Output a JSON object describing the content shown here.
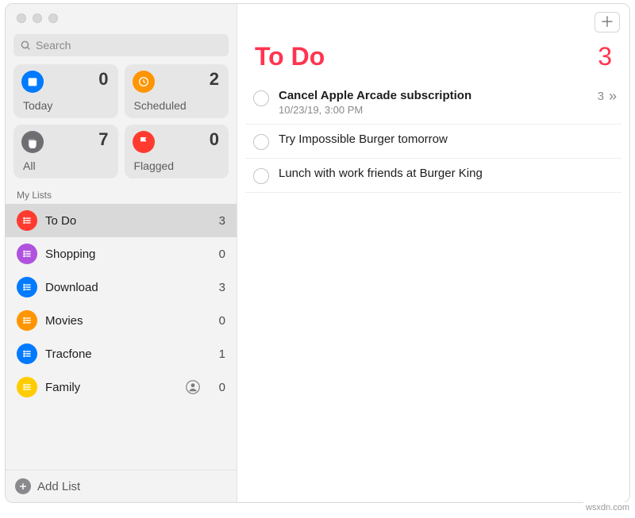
{
  "search": {
    "placeholder": "Search"
  },
  "categories": [
    {
      "id": "today",
      "label": "Today",
      "count": 0,
      "color": "blue"
    },
    {
      "id": "scheduled",
      "label": "Scheduled",
      "count": 2,
      "color": "orange"
    },
    {
      "id": "all",
      "label": "All",
      "count": 7,
      "color": "gray"
    },
    {
      "id": "flagged",
      "label": "Flagged",
      "count": 0,
      "color": "red"
    }
  ],
  "sections": {
    "my_lists_header": "My Lists"
  },
  "lists": [
    {
      "id": "todo",
      "name": "To Do",
      "count": 3,
      "color": "red",
      "selected": true,
      "shared": false
    },
    {
      "id": "shopping",
      "name": "Shopping",
      "count": 0,
      "color": "purple",
      "selected": false,
      "shared": false
    },
    {
      "id": "download",
      "name": "Download",
      "count": 3,
      "color": "blue",
      "selected": false,
      "shared": false
    },
    {
      "id": "movies",
      "name": "Movies",
      "count": 0,
      "color": "orange",
      "selected": false,
      "shared": false
    },
    {
      "id": "tracfone",
      "name": "Tracfone",
      "count": 1,
      "color": "blue",
      "selected": false,
      "shared": false
    },
    {
      "id": "family",
      "name": "Family",
      "count": 0,
      "color": "yellow",
      "selected": false,
      "shared": true
    }
  ],
  "footer": {
    "add_list_label": "Add List"
  },
  "main": {
    "title": "To Do",
    "count": 3,
    "accent": "#ff3550",
    "items": [
      {
        "title": "Cancel Apple Arcade subscription",
        "subtitle": "10/23/19, 3:00 PM",
        "subtasks": 3,
        "bold": true,
        "chevron": true
      },
      {
        "title": "Try Impossible Burger tomorrow"
      },
      {
        "title": "Lunch with work friends at Burger King"
      }
    ]
  },
  "attribution": "wsxdn.com"
}
